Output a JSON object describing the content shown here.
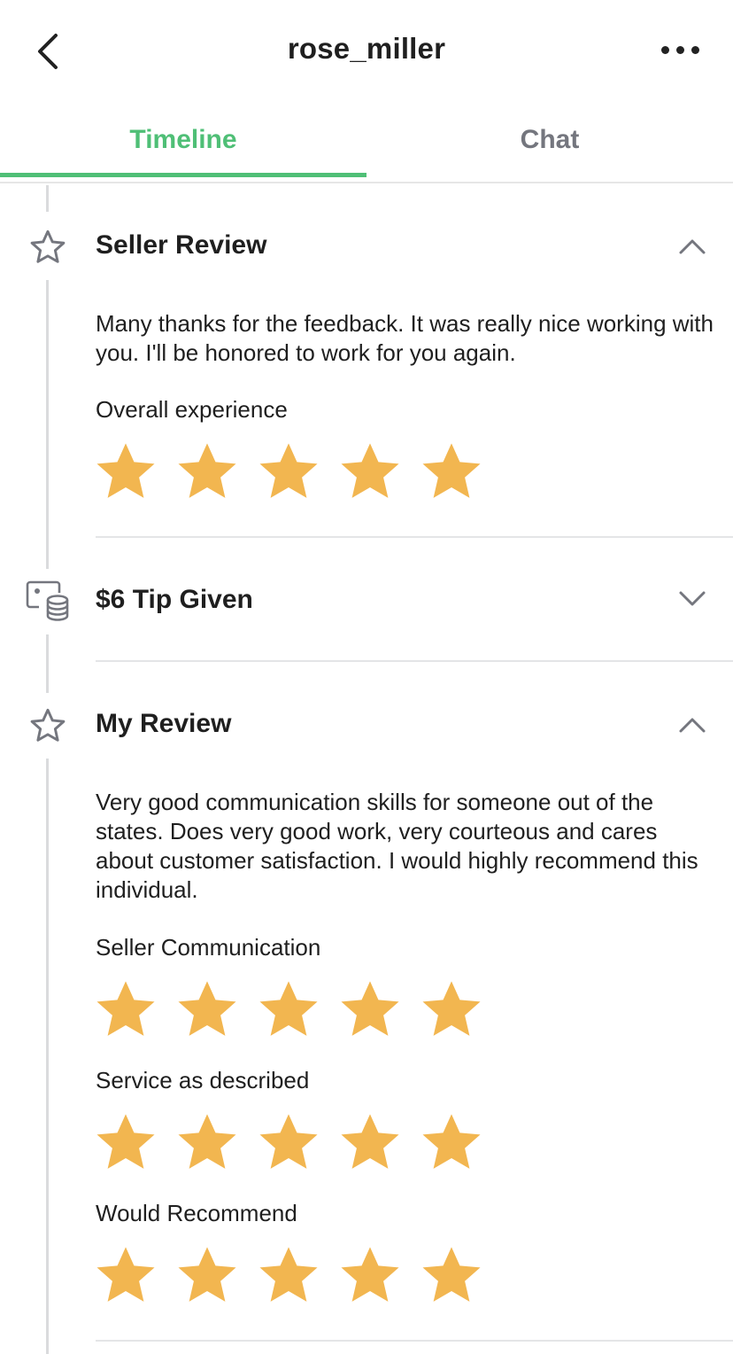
{
  "header": {
    "title": "rose_miller",
    "back_icon": "chevron-left-icon",
    "more_icon": "more-horizontal-icon"
  },
  "tabs": [
    {
      "label": "Timeline",
      "active": true
    },
    {
      "label": "Chat",
      "active": false
    }
  ],
  "colors": {
    "accent": "#4fbf76",
    "star": "#f2b650",
    "inactive_tab": "#74767e"
  },
  "seller_review": {
    "title": "Seller Review",
    "icon": "star-outline-icon",
    "expanded": true,
    "text": "Many thanks for the feedback. It was really nice working with you. I'll be honored to work for you again.",
    "ratings": [
      {
        "label": "Overall experience",
        "stars": 5,
        "max": 5
      }
    ]
  },
  "tip": {
    "title": "$6 Tip Given",
    "icon": "tip-coins-icon",
    "expanded": false
  },
  "my_review": {
    "title": "My Review",
    "icon": "star-outline-icon",
    "expanded": true,
    "text": "Very good communication skills for someone out of the states. Does very good work, very courteous and cares about customer satisfaction. I would highly recommend this individual.",
    "ratings": [
      {
        "label": "Seller Communication",
        "stars": 5,
        "max": 5
      },
      {
        "label": "Service as described",
        "stars": 5,
        "max": 5
      },
      {
        "label": "Would Recommend",
        "stars": 5,
        "max": 5
      }
    ]
  }
}
